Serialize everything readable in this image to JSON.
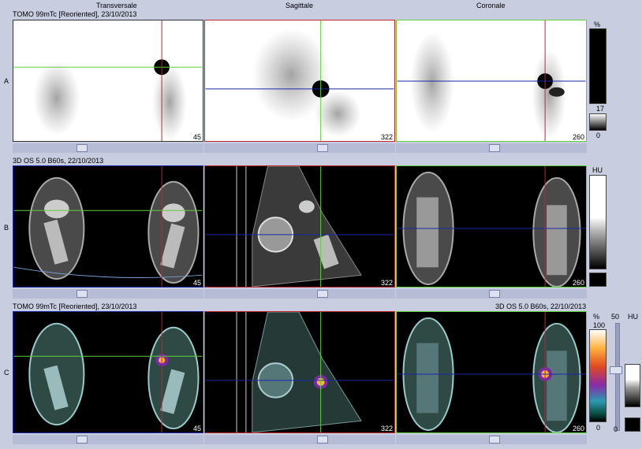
{
  "columns": {
    "transverse": "Transversale",
    "sagittal": "Sagittale",
    "coronal": "Coronale"
  },
  "rows": {
    "a": {
      "label": "A",
      "series": "TOMO 99mTc [Reoriented], 23/10/2013"
    },
    "b": {
      "label": "B",
      "series": "3D  OS  5.0  B60s, 22/10/2013"
    },
    "c": {
      "label": "C",
      "series_left": "TOMO 99mTc [Reoriented], 23/10/2013",
      "series_right": "3D  OS  5.0  B60s, 22/10/2013"
    }
  },
  "slices": {
    "a": [
      "45",
      "322",
      "260"
    ],
    "b": [
      "45",
      "322",
      "260"
    ],
    "c": [
      "45",
      "322",
      "260"
    ]
  },
  "scale_a": {
    "unit": "%",
    "mid": "17",
    "low": "0"
  },
  "scale_b": {
    "unit": "HU"
  },
  "scale_c": {
    "unit_pct": "%",
    "top": "100",
    "low": "0",
    "slider_top": "50",
    "slider_low": "0",
    "unit_hu": "HU"
  },
  "colors": {
    "crosshair_red": "#c0262a",
    "crosshair_green": "#5fcf3a",
    "crosshair_blue": "#1a28a8",
    "frame_bg": "#c8cde0"
  },
  "icons": {
    "lesion": "hot-spot",
    "scroll": "slider-thumb"
  }
}
